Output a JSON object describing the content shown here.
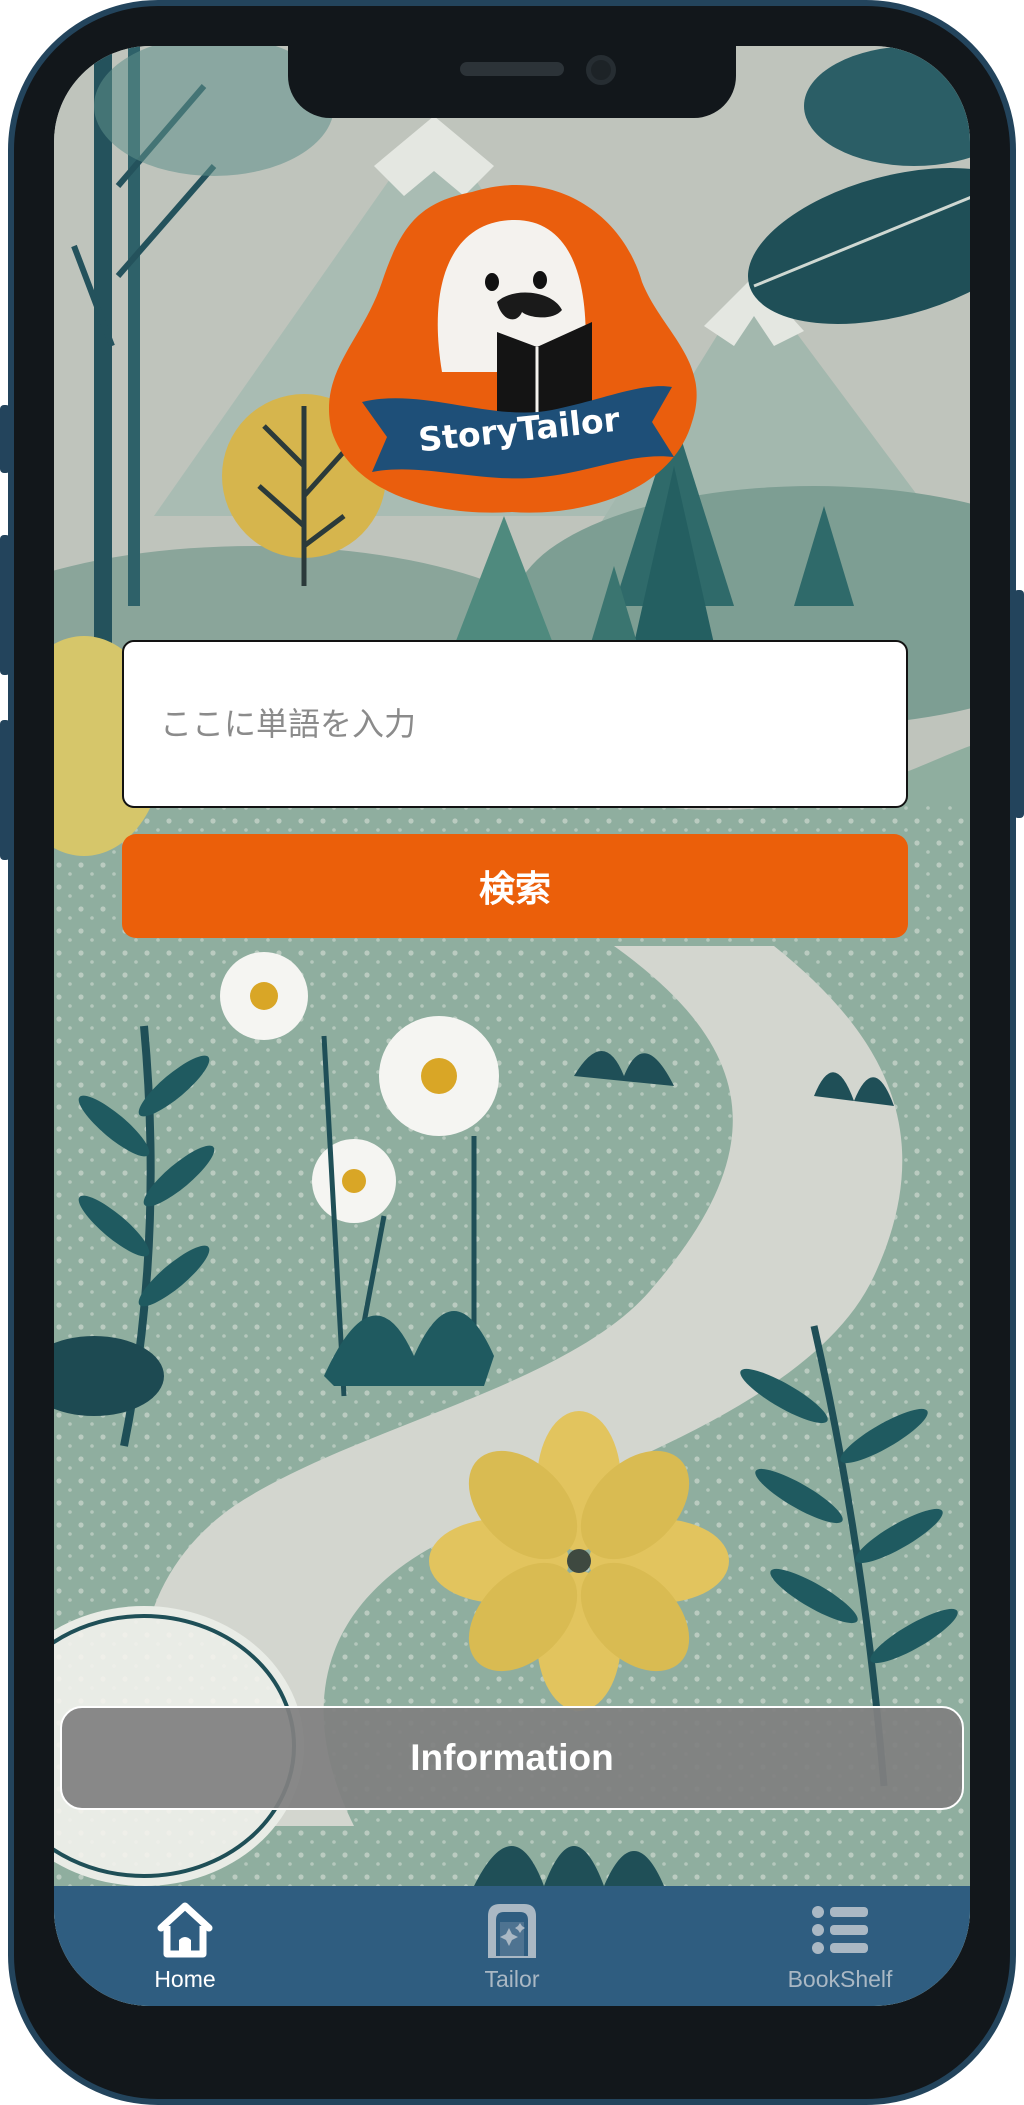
{
  "app": {
    "name": "StoryTailor"
  },
  "logo": {
    "text": "StoryTailor",
    "badge_color": "#ea5e0d",
    "ribbon_color": "#1e4f78"
  },
  "search": {
    "placeholder": "ここに単語を入力",
    "value": "",
    "button_label": "検索",
    "button_color": "#eb5f0a"
  },
  "info": {
    "button_label": "Information"
  },
  "tabbar": {
    "background": "#2f5d80",
    "items": [
      {
        "label": "Home",
        "icon": "home-icon",
        "active": true
      },
      {
        "label": "Tailor",
        "icon": "book-sparkle-icon",
        "active": false
      },
      {
        "label": "BookShelf",
        "icon": "list-icon",
        "active": false
      }
    ]
  }
}
